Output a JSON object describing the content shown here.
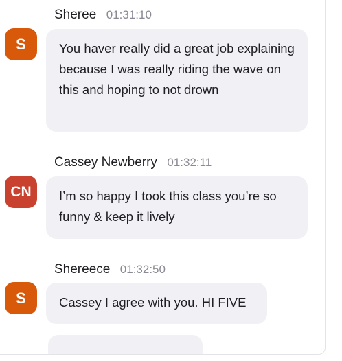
{
  "messages": [
    {
      "author": "Sheree",
      "time": "01:31:10",
      "initials": "S",
      "avatar_color": "#d9590b",
      "text": "You haver really did a great job explaining because I was really riding the wave on this and hoping to not drown"
    },
    {
      "author": "Cassey Newberry",
      "time": "01:32:11",
      "initials": "CN",
      "avatar_color": "#c9412f",
      "text": "I’m so happy I took this class you’re so funny & keep it lively"
    },
    {
      "author": "Shereece",
      "time": "01:32:50",
      "initials": "S",
      "avatar_color": "#d9590b",
      "text": "Cassey I agree with you. HI FIVE"
    }
  ]
}
